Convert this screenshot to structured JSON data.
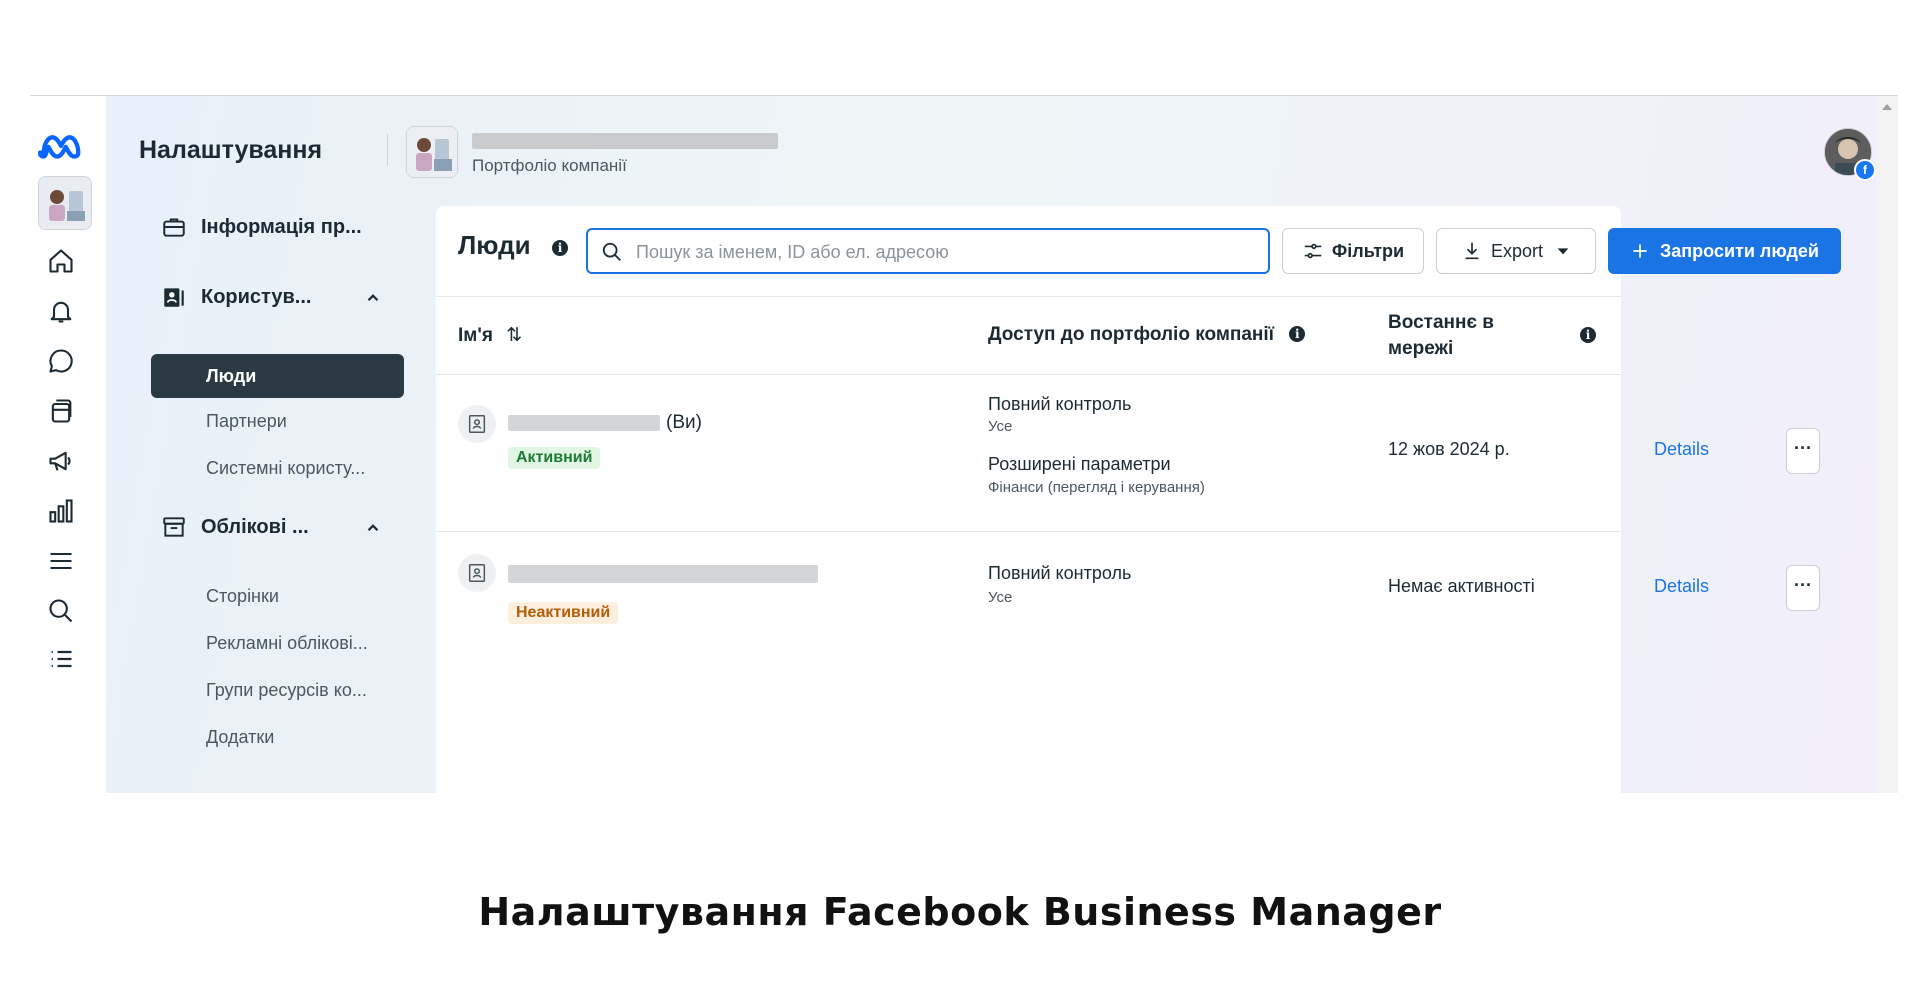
{
  "header": {
    "title": "Налаштування",
    "portfolio_sub": "Портфоліо компанії"
  },
  "rail": {
    "icons": [
      "meta-logo-icon",
      "business-avatar",
      "home-icon",
      "bell-icon",
      "chat-icon",
      "pages-icon",
      "megaphone-icon",
      "chart-icon",
      "menu-icon",
      "search-icon",
      "list-icon"
    ]
  },
  "sidenav": {
    "info_label": "Інформація пр...",
    "users_label": "Користув...",
    "users_items": [
      "Люди",
      "Партнери",
      "Системні користу..."
    ],
    "accounts_label": "Облікові ...",
    "accounts_items": [
      "Сторінки",
      "Рекламні облікові...",
      "Групи ресурсів ко...",
      "Додатки"
    ]
  },
  "people": {
    "title": "Люди",
    "search_placeholder": "Пошук за іменем, ID або ел. адресою",
    "filters_label": "Фільтри",
    "export_label": "Export",
    "invite_label": "Запросити людей",
    "columns": {
      "name": "Ім'я",
      "access": "Доступ до портфоліо компанії",
      "last_online_1": "Востаннє в",
      "last_online_2": "мережі"
    },
    "rows": [
      {
        "name_suffix": "(Ви)",
        "status": "Активний",
        "access_main_1": "Повний контроль",
        "access_sub_1": "Усе",
        "access_main_2": "Розширені параметри",
        "access_sub_2": "Фінанси (перегляд і керування)",
        "last_seen": "12 жов 2024 р.",
        "details": "Details",
        "more": "···"
      },
      {
        "status": "Неактивний",
        "access_main_1": "Повний контроль",
        "access_sub_1": "Усе",
        "last_seen": "Немає активності",
        "details": "Details",
        "more": "···"
      }
    ]
  },
  "caption": "Налаштування Facebook Business Manager",
  "colors": {
    "accent": "#1b74e4",
    "active_nav": "#2b3a42",
    "status_active": "#1e7b34",
    "status_inactive": "#b25e09"
  }
}
